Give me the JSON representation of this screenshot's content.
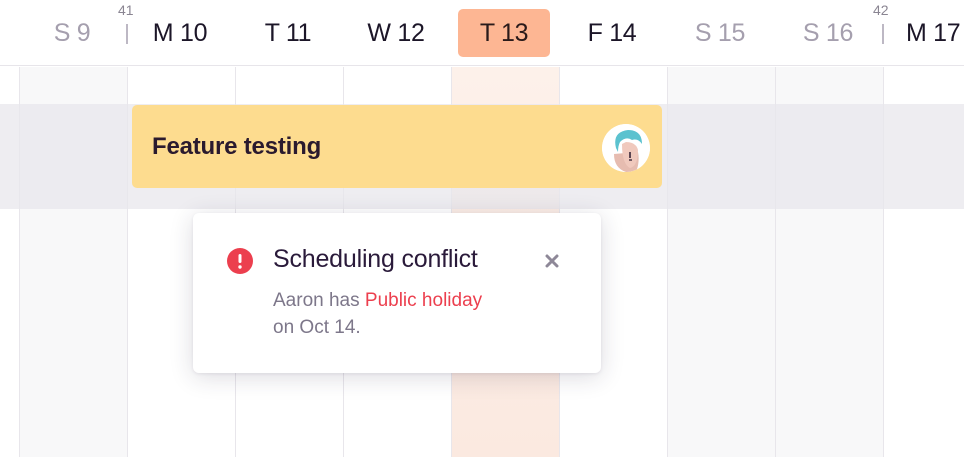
{
  "header": {
    "days": [
      {
        "label": "S 9",
        "weekend": true,
        "today": false
      },
      {
        "label": "M 10",
        "weekend": false,
        "today": false
      },
      {
        "label": "T 11",
        "weekend": false,
        "today": false
      },
      {
        "label": "W 12",
        "weekend": false,
        "today": false
      },
      {
        "label": "T 13",
        "weekend": false,
        "today": true
      },
      {
        "label": "F 14",
        "weekend": false,
        "today": false
      },
      {
        "label": "S 15",
        "weekend": true,
        "today": false
      },
      {
        "label": "S 16",
        "weekend": true,
        "today": false
      },
      {
        "label": "M 17",
        "weekend": false,
        "today": false
      }
    ],
    "week_numbers": [
      "41",
      "42"
    ]
  },
  "task": {
    "title": "Feature testing",
    "color": "#fddc8f",
    "assignee_icon": "avatar-icon"
  },
  "conflict_popover": {
    "title": "Scheduling conflict",
    "icon": "alert-icon",
    "close_icon": "close-icon",
    "message_prefix": "Aaron has ",
    "message_link": "Public holiday",
    "message_suffix": " on Oct 14.",
    "alert_color": "#ec3f4e"
  },
  "colors": {
    "today_highlight": "#fdb693",
    "weekend_text": "#a59fae"
  }
}
